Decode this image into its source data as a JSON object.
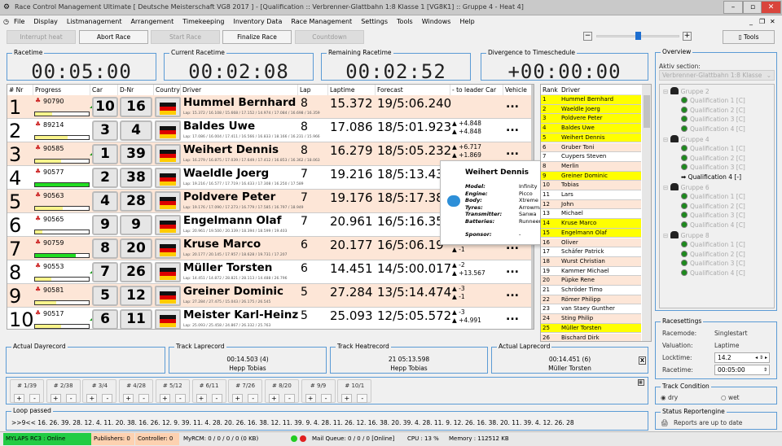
{
  "window": {
    "title": "Race Control Management Ultimate  [ Deutsche Meisterschaft VG8 2017 ] - [Qualification :: Verbrenner-Glattbahn 1:8 Klasse 1  [VG8K1] :: Gruppe 4 - Heat 4]"
  },
  "menu": [
    "File",
    "Display",
    "Listmanagement",
    "Arrangement",
    "Timekeeping",
    "Inventory Data",
    "Race Management",
    "Settings",
    "Tools",
    "Windows",
    "Help"
  ],
  "toolbar": {
    "interrupt": "Interrupt heat",
    "abort": "Abort Race",
    "start": "Start Race",
    "finalize": "Finalize Race",
    "countdown": "Countdown",
    "tools": "Tools",
    "zoom_minus": "−",
    "zoom_plus": "+",
    "zoom_level": 0.5
  },
  "timers": {
    "racetime": {
      "label": "Racetime",
      "value": "00:05:00"
    },
    "current": {
      "label": "Current Racetime",
      "value": "00:02:08"
    },
    "remaining": {
      "label": "Remaining Racetime",
      "value": "00:02:52"
    },
    "divergence": {
      "label": "Divergence to Timeschedule",
      "value": "+00:00:00"
    }
  },
  "table": {
    "headers": [
      "# Nr",
      "Progress",
      "Car",
      "D-Nr",
      "Country",
      "Driver",
      "Lap",
      "Laptime",
      "Forecast",
      "- to leader Car",
      "Vehicle"
    ],
    "rows": [
      {
        "nr": "1",
        "transponder": "90790",
        "progress": 0.32,
        "bar_color": "#fbf58c",
        "up": true,
        "car": "10",
        "dnr": "16",
        "driver": "Hummel Bernhard",
        "laps": "Lap: 15.372 / 16.108 / 15.668 / 17.152 / 14.974 / 17.084 / 16.698 / 16.359",
        "lap": "8",
        "laptime": "15.372",
        "forecast": "19/5:06.240",
        "lead1": "",
        "lead2": "",
        "vehicle": "..."
      },
      {
        "nr": "2",
        "transponder": "89214",
        "progress": 0.6,
        "bar_color": "#fbf58c",
        "up": false,
        "car": "3",
        "dnr": "4",
        "driver": "Baldes Uwe",
        "laps": "Lap: 17.086 / 16.004 / 17.411 / 16.566 / 16.833 / 18.166 / 16.231 / 15.966",
        "lap": "8",
        "laptime": "17.086",
        "forecast": "18/5:01.923",
        "lead1": "+4.848",
        "lead2": "+4.848",
        "vehicle": "..."
      },
      {
        "nr": "3",
        "transponder": "90585",
        "progress": 0.48,
        "bar_color": "#fbf58c",
        "up": true,
        "car": "1",
        "dnr": "39",
        "driver": "Weihert Dennis",
        "laps": "Lap: 16.279 / 16.875 / 17.039 / 17.649 / 17.412 / 16.853 / 16.362 / 18.063",
        "lap": "8",
        "laptime": "16.279",
        "forecast": "18/5:05.232",
        "lead1": "+6.717",
        "lead2": "+1.869",
        "vehicle": "..."
      },
      {
        "nr": "4",
        "transponder": "90577",
        "progress": 1.0,
        "bar_color": "#22dd22",
        "up": false,
        "car": "2",
        "dnr": "38",
        "driver": "Waeldle Joerg",
        "laps": "Lap: 19.216 / 16.577 / 17.719 / 16.433 / 17.308 / 16.250 / 17.589",
        "lap": "7",
        "laptime": "19.216",
        "forecast": "18/5:13.43",
        "lead1": "",
        "lead2": "",
        "vehicle": "..."
      },
      {
        "nr": "5",
        "transponder": "90563",
        "progress": 0.52,
        "bar_color": "#fbf58c",
        "up": false,
        "car": "4",
        "dnr": "28",
        "driver": "Poldvere Peter",
        "laps": "Lap: 19.176 / 17.090 / 17.273 / 16.779 / 17.585 / 16.797 / 18.949",
        "lap": "7",
        "laptime": "19.176",
        "forecast": "18/5:17.38",
        "lead1": "",
        "lead2": "",
        "vehicle": "..."
      },
      {
        "nr": "6",
        "transponder": "90565",
        "progress": 0.14,
        "bar_color": "#fbf58c",
        "up": false,
        "car": "9",
        "dnr": "9",
        "driver": "Engelmann Olaf",
        "laps": "Lap: 20.961 / 19.500 / 20.339 / 18.394 / 18.599 / 19.403",
        "lap": "7",
        "laptime": "20.961",
        "forecast": "16/5:16.35",
        "lead1": "",
        "lead2": "",
        "vehicle": "..."
      },
      {
        "nr": "7",
        "transponder": "90759",
        "progress": 0.75,
        "bar_color": "#22dd22",
        "up": false,
        "car": "8",
        "dnr": "20",
        "driver": "Kruse Marco",
        "laps": "Lap: 20.177 / 20.145 / 17.957 / 18.628 / 19.731 / 17.207",
        "lap": "6",
        "laptime": "20.177",
        "forecast": "16/5:06.19",
        "lead1": "",
        "lead2": "-1",
        "vehicle": "..."
      },
      {
        "nr": "8",
        "transponder": "90553",
        "progress": 0.3,
        "bar_color": "#fbf58c",
        "up": true,
        "car": "7",
        "dnr": "26",
        "driver": "Müller Torsten",
        "laps": "Lap: 14.451 / 14.872 / 28.821 / 28.113 / 14.488 / 26.796",
        "lap": "6",
        "laptime": "14.451",
        "forecast": "14/5:00.017",
        "lead1": "-2",
        "lead2": "+13.567",
        "vehicle": "..."
      },
      {
        "nr": "9",
        "transponder": "90581",
        "progress": 0.4,
        "bar_color": "#fbf58c",
        "up": false,
        "car": "5",
        "dnr": "12",
        "driver": "Greiner Dominic",
        "laps": "Lap: 27.284 / 27.475 / 15.043 / 26.175 / 26.545",
        "lap": "5",
        "laptime": "27.284",
        "forecast": "13/5:14.474",
        "lead1": "-3",
        "lead2": "-1",
        "vehicle": "..."
      },
      {
        "nr": "10",
        "transponder": "90517",
        "progress": 0.48,
        "bar_color": "#fbf58c",
        "up": true,
        "car": "6",
        "dnr": "11",
        "driver": "Meister Karl-Heinz",
        "laps": "Lap: 25.093 / 25.458 / 24.867 / 26.332 / 25.763",
        "lap": "5",
        "laptime": "25.093",
        "forecast": "12/5:05.572",
        "lead1": "-3",
        "lead2": "+4.991",
        "vehicle": "..."
      }
    ]
  },
  "popup": {
    "title": "Weihert Dennis",
    "fields": [
      {
        "k": "Model:",
        "v": "Infinity"
      },
      {
        "k": "Engine:",
        "v": "Picco"
      },
      {
        "k": "Body:",
        "v": "Xtreme"
      },
      {
        "k": "Tyres:",
        "v": "Arrowmax"
      },
      {
        "k": "Transmitter:",
        "v": "Sanwa"
      },
      {
        "k": "Batteries:",
        "v": "RunneerTI"
      },
      {
        "k": "Sponsor:",
        "v": "-"
      }
    ]
  },
  "ranking": {
    "headers": [
      "Rank",
      "Driver"
    ],
    "rows": [
      {
        "r": "1",
        "d": "Hummel Bernhard",
        "hl": true
      },
      {
        "r": "2",
        "d": "Waeldle Joerg",
        "hl": true
      },
      {
        "r": "3",
        "d": "Poldvere Peter",
        "hl": true
      },
      {
        "r": "4",
        "d": "Baldes Uwe",
        "hl": true
      },
      {
        "r": "5",
        "d": "Weihert Dennis",
        "hl": true
      },
      {
        "r": "6",
        "d": "Gruber Toni",
        "hl": false
      },
      {
        "r": "7",
        "d": "Cuypers Steven",
        "hl": false
      },
      {
        "r": "8",
        "d": "Merlin",
        "hl": false
      },
      {
        "r": "9",
        "d": "Greiner Dominic",
        "hl": true
      },
      {
        "r": "10",
        "d": "Tobias",
        "hl": false
      },
      {
        "r": "11",
        "d": "Lars",
        "hl": false
      },
      {
        "r": "12",
        "d": "John",
        "hl": false
      },
      {
        "r": "13",
        "d": "Michael",
        "hl": false
      },
      {
        "r": "14",
        "d": "Kruse Marco",
        "hl": true
      },
      {
        "r": "15",
        "d": "Engelmann Olaf",
        "hl": true
      },
      {
        "r": "16",
        "d": "Oliver",
        "hl": false
      },
      {
        "r": "17",
        "d": "Schäfer Patrick",
        "hl": false
      },
      {
        "r": "18",
        "d": "Wurst Christian",
        "hl": false
      },
      {
        "r": "19",
        "d": "Kammer Michael",
        "hl": false
      },
      {
        "r": "20",
        "d": "Püpke Rene",
        "hl": false
      },
      {
        "r": "21",
        "d": "Schröder Timo",
        "hl": false
      },
      {
        "r": "22",
        "d": "Römer Philipp",
        "hl": false
      },
      {
        "r": "23",
        "d": "van Staey Gunther",
        "hl": false
      },
      {
        "r": "24",
        "d": "Sting Philip",
        "hl": false
      },
      {
        "r": "25",
        "d": "Müller Torsten",
        "hl": true
      },
      {
        "r": "26",
        "d": "Bischard Dirk",
        "hl": false
      }
    ]
  },
  "overview": {
    "label": "Overview",
    "section_label": "Aktiv section:",
    "section_value": "Verbrenner-Glattbahn 1:8 Klasse",
    "groups": [
      {
        "name": "Gruppe 2",
        "items": [
          "Qualification 1  [C]",
          "Qualification 2  [C]",
          "Qualification 3  [C]",
          "Qualification 4  [C]"
        ]
      },
      {
        "name": "Gruppe 4",
        "items": [
          "Qualification 1  [C]",
          "Qualification 2  [C]",
          "Qualification 3  [C]",
          "Qualification 4  [-]"
        ],
        "active": 3
      },
      {
        "name": "Gruppe 6",
        "items": [
          "Qualification 1  [C]",
          "Qualification 2  [C]",
          "Qualification 3  [C]",
          "Qualification 4  [C]"
        ]
      },
      {
        "name": "Gruppe 8",
        "items": [
          "Qualification 1  [C]",
          "Qualification 2  [C]",
          "Qualification 3  [C]",
          "Qualification 4  [C]"
        ]
      }
    ]
  },
  "records": {
    "day": {
      "label": "Actual Dayrecord",
      "line1": "",
      "line2": ""
    },
    "track_lap": {
      "label": "Track Laprecord",
      "line1": "00:14.503 (4)",
      "line2": "Hepp Tobias"
    },
    "track_heat": {
      "label": "Track Heatrecord",
      "line1": "21  05:13.598",
      "line2": "Hepp Tobias"
    },
    "actual_lap": {
      "label": "Actual Laprecord",
      "line1": "00:14.451 (6)",
      "line2": "Müller Torsten"
    },
    "close": "X"
  },
  "car_buttons": [
    "# 1/39",
    "# 2/38",
    "# 3/4",
    "# 4/28",
    "# 5/12",
    "# 6/11",
    "# 7/26",
    "# 8/20",
    "# 9/9",
    "# 10/1"
  ],
  "loop": {
    "label": "Loop passed",
    "value": ">>9<< 16. 26. 39. 28. 12. 4. 11. 20. 38. 16. 26. 12. 9. 39. 11. 4. 28. 20. 26. 16. 38. 12. 11. 39. 9. 4. 28. 11. 26. 12. 16. 38. 20. 39. 4. 28. 11. 9. 12. 26. 16. 38. 20. 11. 39. 4. 12. 26. 28"
  },
  "racesettings": {
    "label": "Racesettings",
    "racemode_label": "Racemode:",
    "racemode": "Singlestart",
    "valuation_label": "Valuation:",
    "valuation": "Laptime",
    "locktime_label": "Locktime:",
    "locktime": "14.2",
    "racetime_label": "Racetime:",
    "racetime": "00:05:00"
  },
  "track": {
    "label": "Track Condition",
    "dry": "dry",
    "wet": "wet",
    "selected": "dry"
  },
  "report": {
    "label": "Status Reportengine",
    "value": "Reports are up to date"
  },
  "status": {
    "mylaps": "MYLAPS RC3 : Online",
    "publishers": "Publishers: 0",
    "controller": "Controller: 0",
    "myrcm": "MyRCM: 0 / 0 / 0 / 0 (0 KB)",
    "mail": "Mail Queue: 0 / 0 / 0 [Online]",
    "cpu": "CPU : 13 %",
    "memory": "Memory : 112512 KB"
  },
  "colors": {
    "row_odd": "#fde6d7",
    "highlight": "#ffff00",
    "online": "#22cc44",
    "accent": "#5b9bd5"
  }
}
